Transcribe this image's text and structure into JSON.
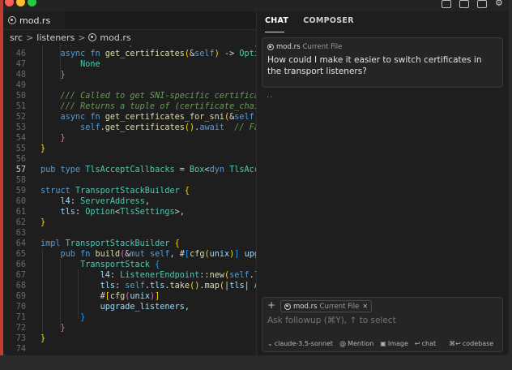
{
  "editor": {
    "tab_label": "mod.rs",
    "breadcrumb": {
      "folder1": "src",
      "folder2": "listeners",
      "file": "mod.rs"
    },
    "current_line": 57
  },
  "panel": {
    "tabs": [
      "CHAT",
      "COMPOSER"
    ],
    "message": {
      "file": "mod.rs",
      "file_sub": "Current File",
      "text": "How could I make it easier to switch certificates in the transport listeners?"
    },
    "loading": "..",
    "composer": {
      "file": "mod.rs",
      "file_sub": "Current File",
      "placeholder": "Ask followup (⌘Y), ↑ to select",
      "model": "claude-3.5-sonnet",
      "mention": "Mention",
      "image": "Image",
      "chat": "chat",
      "codebase": "codebase",
      "chat_shortcut": "↩",
      "codebase_shortcut": "⌘↩"
    }
  },
  "colors": {
    "accent_red": "#ff5f57",
    "accent_yellow": "#febc2e",
    "accent_green": "#28c840"
  }
}
